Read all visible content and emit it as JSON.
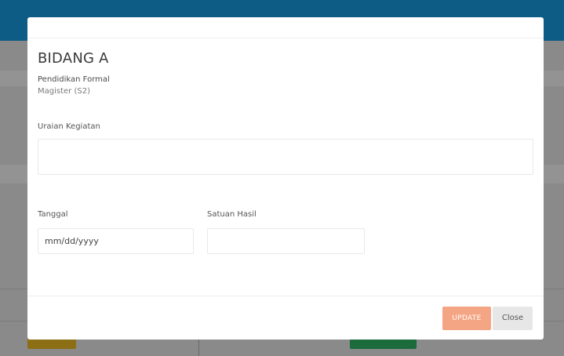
{
  "modal": {
    "title": "BIDANG A",
    "subtitle_line1": "Pendidikan Formal",
    "subtitle_line2": "Magister (S2)",
    "fields": {
      "uraian_label": "Uraian Kegiatan",
      "uraian_value": "",
      "tanggal_label": "Tanggal",
      "tanggal_value": "mm/dd/yyyy",
      "satuan_label": "Satuan Hasil",
      "satuan_value": ""
    },
    "buttons": {
      "update_label": "UPDATE",
      "close_label": "Close"
    }
  },
  "colors": {
    "header_bar": "#0d5c86",
    "update_button": "#f4a583",
    "close_button": "#e7e7e7",
    "background_yellow_button": "#8c6f14",
    "background_green_button": "#1c6b3c"
  }
}
